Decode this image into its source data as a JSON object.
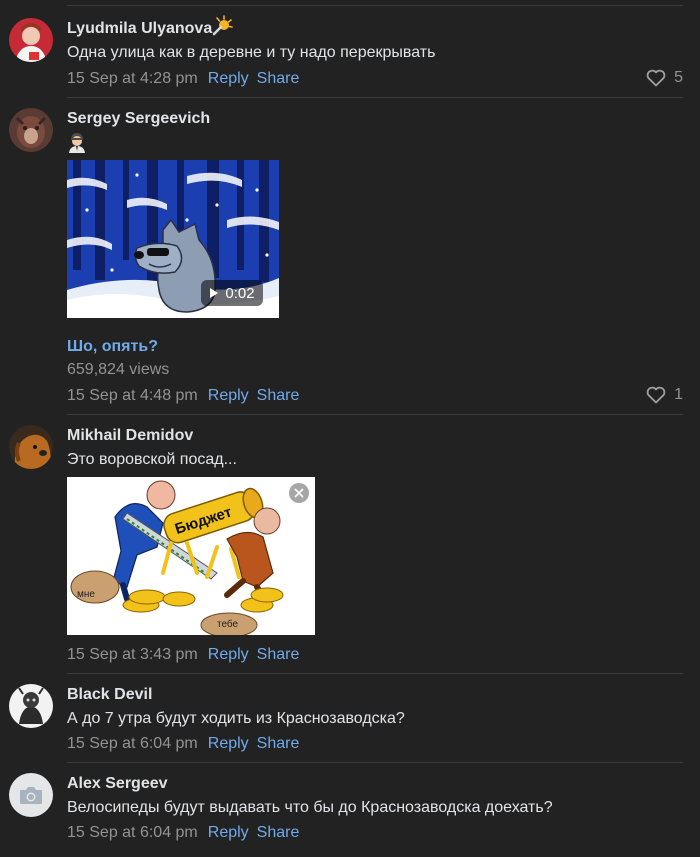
{
  "comments": [
    {
      "author": "Lyudmila Ulyanova",
      "text": "Одна улица как в деревне и ту надо перекрывать",
      "time": "15 Sep at 4:28 pm",
      "reply": "Reply",
      "share": "Share",
      "likes": "5"
    },
    {
      "author": "Sergey Sergeevich",
      "video": {
        "duration": "0:02",
        "title": "Шо, опять?",
        "views": "659,824 views"
      },
      "time": "15 Sep at 4:48 pm",
      "reply": "Reply",
      "share": "Share",
      "likes": "1"
    },
    {
      "author": "Mikhail Demidov",
      "text": "Это воровской посад...",
      "image_labels": [
        "Бюджет",
        "мне",
        "тебе"
      ],
      "time": "15 Sep at 3:43 pm",
      "reply": "Reply",
      "share": "Share"
    },
    {
      "author": "Black Devil",
      "text": "А до 7 утра будут ходить из Краснозаводска?",
      "time": "15 Sep at 6:04 pm",
      "reply": "Reply",
      "share": "Share"
    },
    {
      "author": "Alex Sergeev",
      "text": "Велосипеды будут выдавать что бы до Краснозаводска доехать?",
      "time": "15 Sep at 6:04 pm",
      "reply": "Reply",
      "share": "Share"
    }
  ],
  "colors": {
    "background": "#222222",
    "link": "#71aaeb",
    "muted": "#939393",
    "text": "#e1e3e6"
  }
}
